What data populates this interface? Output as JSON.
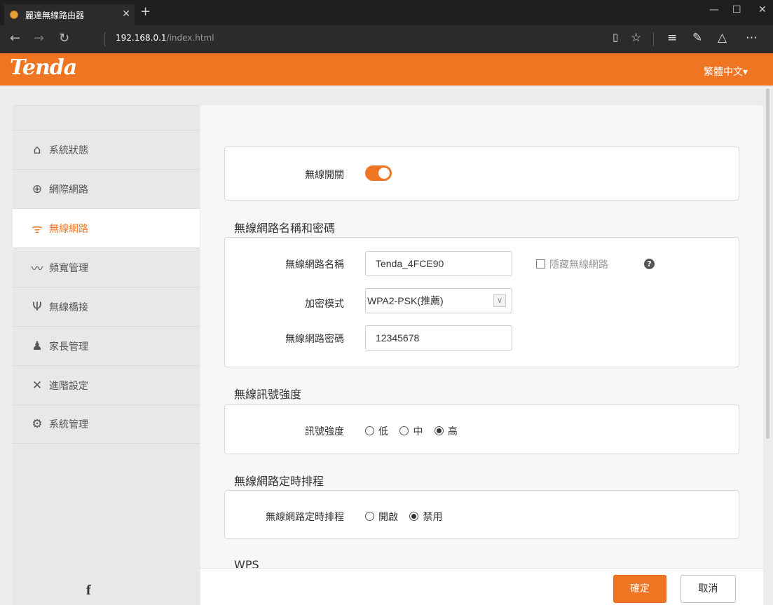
{
  "browser": {
    "tab_title": "麗達無線路由器",
    "tab_close": "✕",
    "new_tab": "+",
    "url_host": "192.168.0.1",
    "url_path": "/index.html",
    "icons": [
      "back-icon",
      "forward-icon",
      "refresh-icon",
      "reading-view-icon",
      "favorite-icon",
      "hub-icon",
      "web-note-icon",
      "share-icon",
      "more-icon"
    ]
  },
  "header": {
    "logo": "Tenda",
    "language": "繁體中文▾"
  },
  "sidebar": {
    "items": [
      {
        "label": "系統狀態",
        "icon": "router-icon",
        "glyph": "⌂",
        "active": false
      },
      {
        "label": "網際網路",
        "icon": "globe-icon",
        "glyph": "⊕",
        "active": false
      },
      {
        "label": "無線網路",
        "icon": "wifi-icon",
        "glyph": "ᯤ",
        "active": true
      },
      {
        "label": "頻寬管理",
        "icon": "bandwidth-icon",
        "glyph": "〰",
        "active": false
      },
      {
        "label": "無線橋接",
        "icon": "antenna-icon",
        "glyph": "Ψ",
        "active": false
      },
      {
        "label": "家長管理",
        "icon": "parent-child-icon",
        "glyph": "♟",
        "active": false
      },
      {
        "label": "進階設定",
        "icon": "tools-icon",
        "glyph": "✕",
        "active": false
      },
      {
        "label": "系統管理",
        "icon": "gears-icon",
        "glyph": "⚙",
        "active": false
      }
    ],
    "facebook": "f"
  },
  "wireless": {
    "switch_label": "無線開關",
    "switch_on": true,
    "name_section_title": "無線網路名稱和密碼",
    "ssid_label": "無線網路名稱",
    "ssid_value": "Tenda_4FCE90",
    "hide_label": "隱藏無線網路",
    "hide_checked": false,
    "help_glyph": "?",
    "security_label": "加密模式",
    "security_value": "WPA2-PSK(推薦)",
    "password_label": "無線網路密碼",
    "password_value": "12345678",
    "signal_section_title": "無線訊號強度",
    "signal_label": "訊號強度",
    "signal_options": [
      "低",
      "中",
      "高"
    ],
    "signal_selected": "高",
    "schedule_section_title": "無線網路定時排程",
    "schedule_label": "無線網路定時排程",
    "schedule_options": [
      "開啟",
      "禁用"
    ],
    "schedule_selected": "禁用",
    "wps_section_title": "WPS"
  },
  "footer": {
    "ok_label": "確定",
    "cancel_label": "取消"
  },
  "colors": {
    "accent": "#f07523",
    "titlebar": "#1f1f1f",
    "addressbar": "#2b2b2b"
  }
}
